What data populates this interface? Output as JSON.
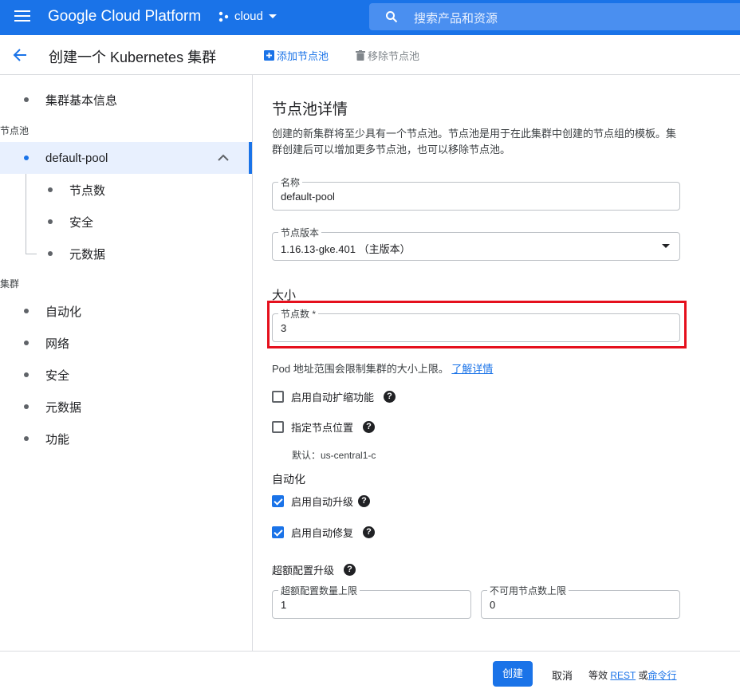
{
  "topbar": {
    "brand": "Google Cloud Platform",
    "project": "cloud",
    "search_placeholder": "搜索产品和资源"
  },
  "subheader": {
    "title": "创建一个 Kubernetes 集群",
    "add_node_pool": "添加节点池",
    "remove_node_pool": "移除节点池"
  },
  "sidebar": {
    "basic_info": "集群基本信息",
    "node_pools_section": "节点池",
    "default_pool": "default-pool",
    "pool_children": [
      "节点数",
      "安全",
      "元数据"
    ],
    "cluster_section": "集群",
    "cluster_items": [
      "自动化",
      "网络",
      "安全",
      "元数据",
      "功能"
    ]
  },
  "main": {
    "title": "节点池详情",
    "description": "创建的新集群将至少具有一个节点池。节点池是用于在此集群中创建的节点组的模板。集群创建后可以增加更多节点池，也可以移除节点池。",
    "name_field": {
      "label": "名称",
      "value": "default-pool"
    },
    "version_field": {
      "label": "节点版本",
      "value": "1.16.13-gke.401 （主版本）"
    },
    "size_title": "大小",
    "node_count_field": {
      "label": "节点数 *",
      "value": "3"
    },
    "pod_hint": "Pod 地址范围会限制集群的大小上限。",
    "learn_more": "了解详情",
    "autoscaling": {
      "label": "启用自动扩缩功能",
      "checked": false
    },
    "node_locations": {
      "label": "指定节点位置",
      "checked": false
    },
    "default_location": "默认：us-central1-c",
    "automation_title": "自动化",
    "auto_upgrade": {
      "label": "启用自动升级",
      "checked": true
    },
    "auto_repair": {
      "label": "启用自动修复",
      "checked": true
    },
    "surge_title": "超额配置升级",
    "max_surge": {
      "label": "超额配置数量上限",
      "value": "1"
    },
    "max_unavailable": {
      "label": "不可用节点数上限",
      "value": "0"
    },
    "help_glyph": "?"
  },
  "footer": {
    "create": "创建",
    "cancel": "取消",
    "equiv_prefix": "等效",
    "rest": "REST",
    "or": "或",
    "command_line": "命令行"
  },
  "colors": {
    "primary": "#1a73e8",
    "highlight_border": "#e5101d",
    "border": "#dadce0"
  }
}
